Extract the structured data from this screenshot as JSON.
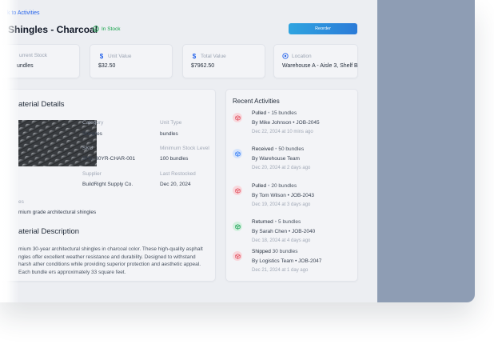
{
  "nav": {
    "back_label": "k to Activities"
  },
  "product": {
    "name": "Shingles - Charcoal",
    "stock_status": "In Stock",
    "reorder_label": "Reorder"
  },
  "stats": [
    {
      "label": "urrent Stock",
      "value": "undles",
      "icon": "box-icon"
    },
    {
      "label": "Unit Value",
      "value": "$32.50",
      "icon": "dollar-icon"
    },
    {
      "label": "Total Value",
      "value": "$7962.50",
      "icon": "dollar-icon"
    },
    {
      "label": "Location",
      "value": "Warehouse A - Aisle 3, Shelf B",
      "icon": "location-pin-icon"
    }
  ],
  "details": {
    "title": "aterial Details",
    "fields": {
      "category_label": "Category",
      "category_value": "Shingles",
      "unit_label": "Unit Type",
      "unit_value": "bundles",
      "sku_label": "SKU",
      "sku_value": "SHG-30YR-CHAR-001",
      "min_label": "Minimum Stock Level",
      "min_value": "100 bundles",
      "supplier_label": "Supplier",
      "supplier_value": "BuildRight Supply Co.",
      "restock_label": "Last Restocked",
      "restock_value": "Dec 20, 2024"
    },
    "notes_label": "es",
    "notes_value": "mium grade architectural shingles",
    "description_title": "aterial Description",
    "description_text": "mium 30-year architectural shingles in charcoal color. These high-quality asphalt ngles offer excellent weather resistance and durability. Designed to withstand harsh ather conditions while providing superior protection and aesthetic appeal. Each bundle ers approximately 33 square feet."
  },
  "activities": {
    "title": "Recent Activities",
    "items": [
      {
        "action": "Pulled",
        "qty": "15 bundles",
        "by": "By Mike Johnson • JOB-2045",
        "time": "Dec 22, 2024 at 10 mins ago",
        "color": "#e25563",
        "bg": "#f8d7dc",
        "sep": "•"
      },
      {
        "action": "Received",
        "qty": "50 bundles",
        "by": "By Warehouse Team",
        "time": "Dec 20, 2024 at 2 days ago",
        "color": "#3b82f6",
        "bg": "#d6e4fb",
        "sep": "•"
      },
      {
        "action": "Pulled",
        "qty": "20 bundles",
        "by": "By Tom Wilson • JOB-2043",
        "time": "Dec 19, 2024 at 3 days ago",
        "color": "#e25563",
        "bg": "#f8d7dc",
        "sep": "•"
      },
      {
        "action": "Returned",
        "qty": "5 bundles",
        "by": "By Sarah Chen • JOB-2040",
        "time": "Dec 18, 2024 at 4 days ago",
        "color": "#22a55b",
        "bg": "#d3f0df",
        "sep": "•"
      },
      {
        "action": "Shipped",
        "qty": "30 bundles",
        "by": "By Logistics Team • JOB-2047",
        "time": "Dec 21, 2024 at 1 day ago",
        "color": "#e25563",
        "bg": "#f8d7dc",
        "sep": ""
      }
    ]
  }
}
